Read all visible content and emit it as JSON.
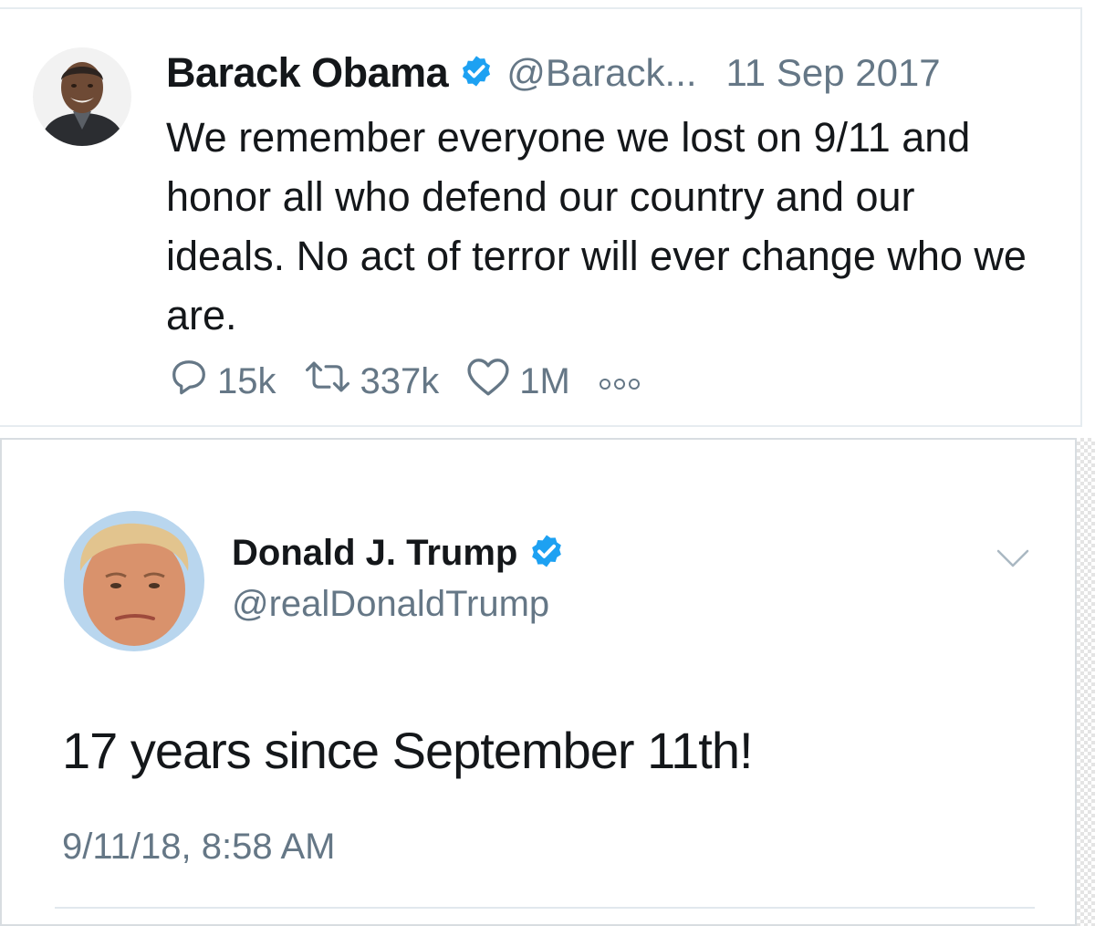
{
  "tweet_obama": {
    "name": "Barack Obama",
    "handle": "@Barack...",
    "date": "11 Sep 2017",
    "text": "We remember everyone we lost on 9/11 and honor all who defend our country and our ideals. No act of terror will ever change who we are.",
    "replies": "15k",
    "retweets": "337k",
    "likes": "1M"
  },
  "tweet_trump": {
    "name": "Donald J. Trump",
    "handle": "@realDonaldTrump",
    "text": "17 years since September 11th!",
    "timestamp": "9/11/18, 8:58 AM"
  },
  "colors": {
    "verified_blue": "#1da1f2",
    "secondary_gray": "#657786",
    "text_black": "#14171a"
  }
}
